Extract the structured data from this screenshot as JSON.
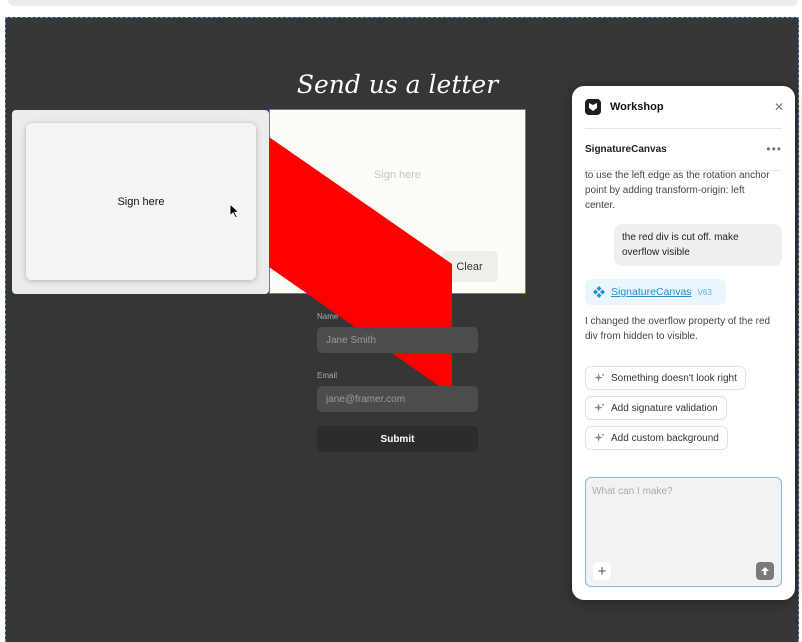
{
  "app": {
    "accent_selection": "#7b61ff",
    "canvas_bg": "#363636"
  },
  "page": {
    "heading": "Send us a letter",
    "left_card_label": "Sign here",
    "signature_placeholder": "Sign here",
    "clear_label": "Clear",
    "red_color": "#ff0000",
    "form": {
      "name_label": "Name",
      "name_placeholder": "Jane Smith",
      "email_label": "Email",
      "email_placeholder": "jane@framer.com",
      "submit_label": "Submit"
    }
  },
  "workshop": {
    "title": "Workshop",
    "close_icon": "close-icon",
    "component_name": "SignatureCanvas",
    "more_label": "•••",
    "assistant_msg_1": "to use the left edge as the rotation anchor point by adding transform-origin: left center.",
    "user_msg": "the red div is cut off. make overflow visible",
    "chip_name": "SignatureCanvas",
    "chip_version": "V63",
    "assistant_msg_2": "I changed the overflow property of the red div from hidden to visible.",
    "suggestions": [
      "Something doesn't look right",
      "Add signature validation",
      "Add custom background"
    ],
    "prompt_placeholder": "What can I make?",
    "add_label": "+"
  }
}
